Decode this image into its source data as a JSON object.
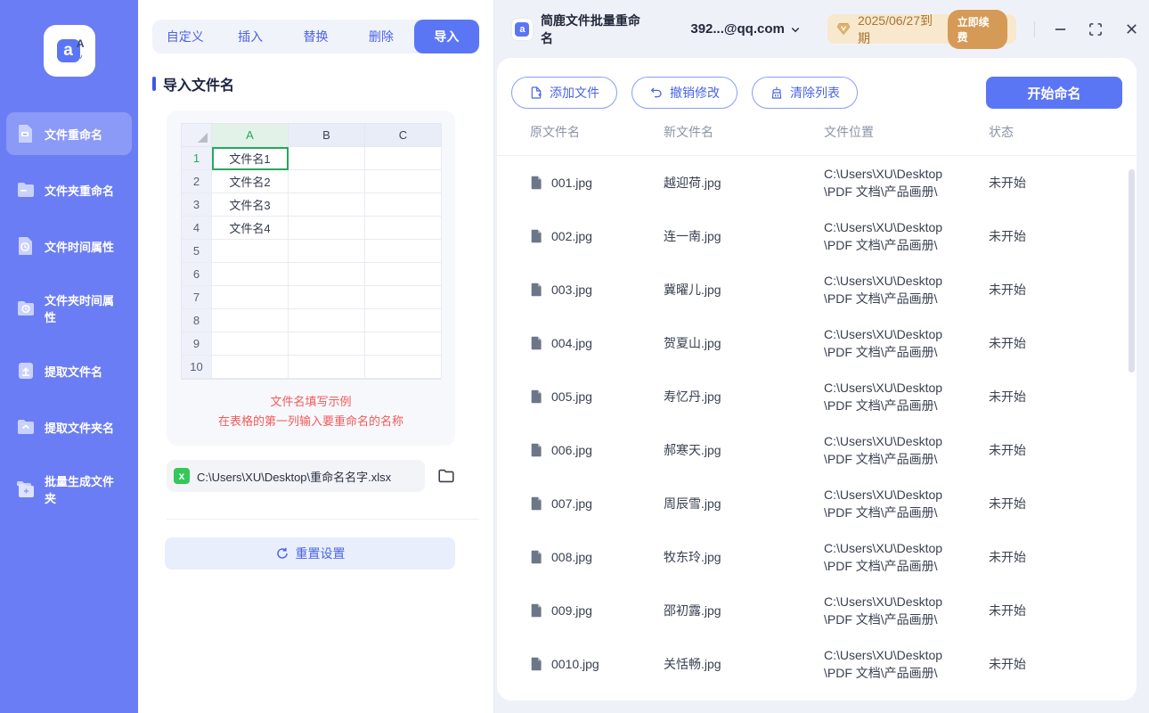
{
  "window": {
    "app_title": "简鹿文件批量重命名",
    "account": "392...@qq.com",
    "license_expiry": "2025/06/27到期",
    "renew_label": "立即续费"
  },
  "sidebar": {
    "items": [
      {
        "label": "文件重命名",
        "active": true
      },
      {
        "label": "文件夹重命名",
        "active": false
      },
      {
        "label": "文件时间属性",
        "active": false
      },
      {
        "label": "文件夹时间属性",
        "active": false
      },
      {
        "label": "提取文件名",
        "active": false
      },
      {
        "label": "提取文件夹名",
        "active": false
      },
      {
        "label": "批量生成文件夹",
        "active": false
      }
    ]
  },
  "tabs": [
    {
      "label": "自定义",
      "active": false
    },
    {
      "label": "插入",
      "active": false
    },
    {
      "label": "替换",
      "active": false
    },
    {
      "label": "删除",
      "active": false
    },
    {
      "label": "导入",
      "active": true
    }
  ],
  "import_panel": {
    "section_title": "导入文件名",
    "sheet": {
      "col_a": "A",
      "col_b": "B",
      "col_c": "C",
      "rows": [
        {
          "n": "1",
          "a": "文件名1",
          "cls": "sel"
        },
        {
          "n": "2",
          "a": "文件名2"
        },
        {
          "n": "3",
          "a": "文件名3"
        },
        {
          "n": "4",
          "a": "文件名4"
        },
        {
          "n": "5",
          "a": ""
        },
        {
          "n": "6",
          "a": ""
        },
        {
          "n": "7",
          "a": ""
        },
        {
          "n": "8",
          "a": ""
        },
        {
          "n": "9",
          "a": ""
        },
        {
          "n": "10",
          "a": ""
        }
      ]
    },
    "hint_line1": "文件名填写示例",
    "hint_line2": "在表格的第一列输入要重命名的名称",
    "file_path": "C:\\Users\\XU\\Desktop\\重命名名字.xlsx",
    "excel_icon_label": "x",
    "reset_label": "重置设置"
  },
  "toolbar": {
    "add_label": "添加文件",
    "undo_label": "撤销修改",
    "clear_label": "清除列表",
    "start_label": "开始命名"
  },
  "table": {
    "headers": {
      "original": "原文件名",
      "new_name": "新文件名",
      "location": "文件位置",
      "status": "状态"
    },
    "rows": [
      {
        "original": "001.jpg",
        "new_name": "越迎荷.jpg",
        "loc1": "C:\\Users\\XU\\Desktop",
        "loc2": "\\PDF 文档\\产品画册\\",
        "status": "未开始"
      },
      {
        "original": "002.jpg",
        "new_name": "连一南.jpg",
        "loc1": "C:\\Users\\XU\\Desktop",
        "loc2": "\\PDF 文档\\产品画册\\",
        "status": "未开始"
      },
      {
        "original": "003.jpg",
        "new_name": "冀曜儿.jpg",
        "loc1": "C:\\Users\\XU\\Desktop",
        "loc2": "\\PDF 文档\\产品画册\\",
        "status": "未开始"
      },
      {
        "original": "004.jpg",
        "new_name": "贺夏山.jpg",
        "loc1": "C:\\Users\\XU\\Desktop",
        "loc2": "\\PDF 文档\\产品画册\\",
        "status": "未开始"
      },
      {
        "original": "005.jpg",
        "new_name": "寿忆丹.jpg",
        "loc1": "C:\\Users\\XU\\Desktop",
        "loc2": "\\PDF 文档\\产品画册\\",
        "status": "未开始"
      },
      {
        "original": "006.jpg",
        "new_name": "郝寒天.jpg",
        "loc1": "C:\\Users\\XU\\Desktop",
        "loc2": "\\PDF 文档\\产品画册\\",
        "status": "未开始"
      },
      {
        "original": "007.jpg",
        "new_name": "周辰雪.jpg",
        "loc1": "C:\\Users\\XU\\Desktop",
        "loc2": "\\PDF 文档\\产品画册\\",
        "status": "未开始"
      },
      {
        "original": "008.jpg",
        "new_name": "牧东玲.jpg",
        "loc1": "C:\\Users\\XU\\Desktop",
        "loc2": "\\PDF 文档\\产品画册\\",
        "status": "未开始"
      },
      {
        "original": "009.jpg",
        "new_name": "邵初露.jpg",
        "loc1": "C:\\Users\\XU\\Desktop",
        "loc2": "\\PDF 文档\\产品画册\\",
        "status": "未开始"
      },
      {
        "original": "0010.jpg",
        "new_name": "关恬畅.jpg",
        "loc1": "C:\\Users\\XU\\Desktop",
        "loc2": "\\PDF 文档\\产品画册\\",
        "status": "未开始"
      }
    ]
  },
  "colors": {
    "accent": "#5b76f5",
    "sidebar": "#6b7df5",
    "hint_red": "#f25a5a",
    "sheet_green": "#27a75f",
    "vip_bg": "#f8e8cd",
    "vip_btn": "#d59a56"
  }
}
